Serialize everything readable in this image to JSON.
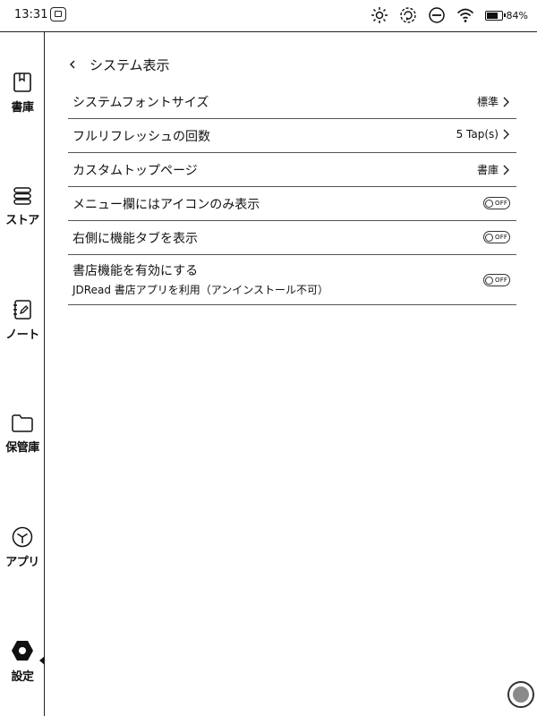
{
  "status_bar": {
    "time": "13:31",
    "battery_percent": "84%",
    "battery_level": 0.84,
    "icons": [
      "cast-icon",
      "brightness-icon",
      "refresh-mode-icon",
      "do-not-disturb-icon",
      "wifi-icon",
      "battery-icon"
    ]
  },
  "sidebar": {
    "items": [
      {
        "label": "書庫",
        "icon": "library-icon"
      },
      {
        "label": "ストア",
        "icon": "store-icon"
      },
      {
        "label": "ノート",
        "icon": "notes-icon"
      },
      {
        "label": "保管庫",
        "icon": "storage-folder-icon"
      },
      {
        "label": "アプリ",
        "icon": "apps-icon"
      },
      {
        "label": "設定",
        "icon": "settings-icon",
        "selected": true
      }
    ]
  },
  "header": {
    "title": "システム表示"
  },
  "settings": {
    "rows": [
      {
        "label": "システムフォントサイズ",
        "value": "標準"
      },
      {
        "label": "フルリフレッシュの回数",
        "value": "5 Tap(s)"
      },
      {
        "label": "カスタムトップページ",
        "value": "書庫"
      },
      {
        "label": "メニュー欄にはアイコンのみ表示",
        "toggle": "OFF"
      },
      {
        "label": "右側に機能タブを表示",
        "toggle": "OFF"
      },
      {
        "label": "書店機能を有効にする",
        "sublabel": "JDRead 書店アプリを利用（アンインストール不可）",
        "toggle": "OFF"
      }
    ]
  },
  "floating_button": {
    "icon": "floating-menu-button-icon"
  }
}
